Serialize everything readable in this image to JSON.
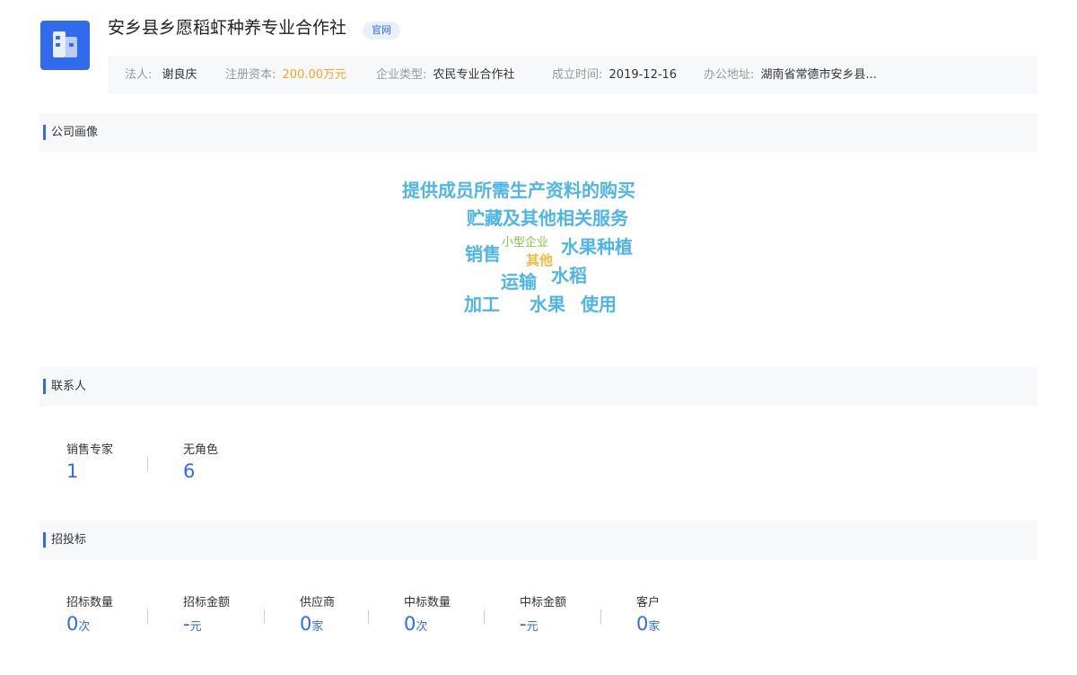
{
  "company": {
    "name": "安乡县乡愿稻虾种养专业合作社",
    "site_tag": "官网",
    "legal_person_label": "法人:",
    "legal_person": "谢良庆",
    "capital_label": "注册资本:",
    "capital": "200.00万元",
    "type_label": "企业类型:",
    "type": "农民专业合作社",
    "founded_label": "成立时间:",
    "founded": "2019-12-16",
    "address_label": "办公地址:",
    "address": "湖南省常德市安乡县..."
  },
  "portrait": {
    "title": "公司画像",
    "words": [
      {
        "text": "提供成员所需生产资料的购买",
        "color": "#4fb5e8"
      },
      {
        "text": "贮藏及其他相关服务",
        "color": "#4fb5e8"
      },
      {
        "text": "销售",
        "color": "#4fb5e8"
      },
      {
        "text": "小型企业",
        "color": "#8bc34a"
      },
      {
        "text": "其他",
        "color": "#f5b83d"
      },
      {
        "text": "水果种植",
        "color": "#4fb5e8"
      },
      {
        "text": "运输",
        "color": "#4fb5e8"
      },
      {
        "text": "水稻",
        "color": "#4fb5e8"
      },
      {
        "text": "加工",
        "color": "#4fb5e8"
      },
      {
        "text": "水果",
        "color": "#4fb5e8"
      },
      {
        "text": "使用",
        "color": "#4fb5e8"
      }
    ]
  },
  "contacts": {
    "title": "联系人",
    "stats": [
      {
        "label": "销售专家",
        "value": "1",
        "unit": ""
      },
      {
        "label": "无角色",
        "value": "6",
        "unit": ""
      }
    ]
  },
  "bidding": {
    "title": "招投标",
    "stats": [
      {
        "label": "招标数量",
        "value": "0",
        "unit": "次"
      },
      {
        "label": "招标金额",
        "value": "-",
        "unit": "元"
      },
      {
        "label": "供应商",
        "value": "0",
        "unit": "家"
      },
      {
        "label": "中标数量",
        "value": "0",
        "unit": "次"
      },
      {
        "label": "中标金额",
        "value": "-",
        "unit": "元"
      },
      {
        "label": "客户",
        "value": "0",
        "unit": "家"
      }
    ]
  },
  "colors": {
    "accent": "#2f6bec",
    "capital": "#f5a623",
    "cloud_main": "#4fb5e8",
    "cloud_green": "#8bc34a",
    "cloud_orange": "#f5b83d"
  }
}
